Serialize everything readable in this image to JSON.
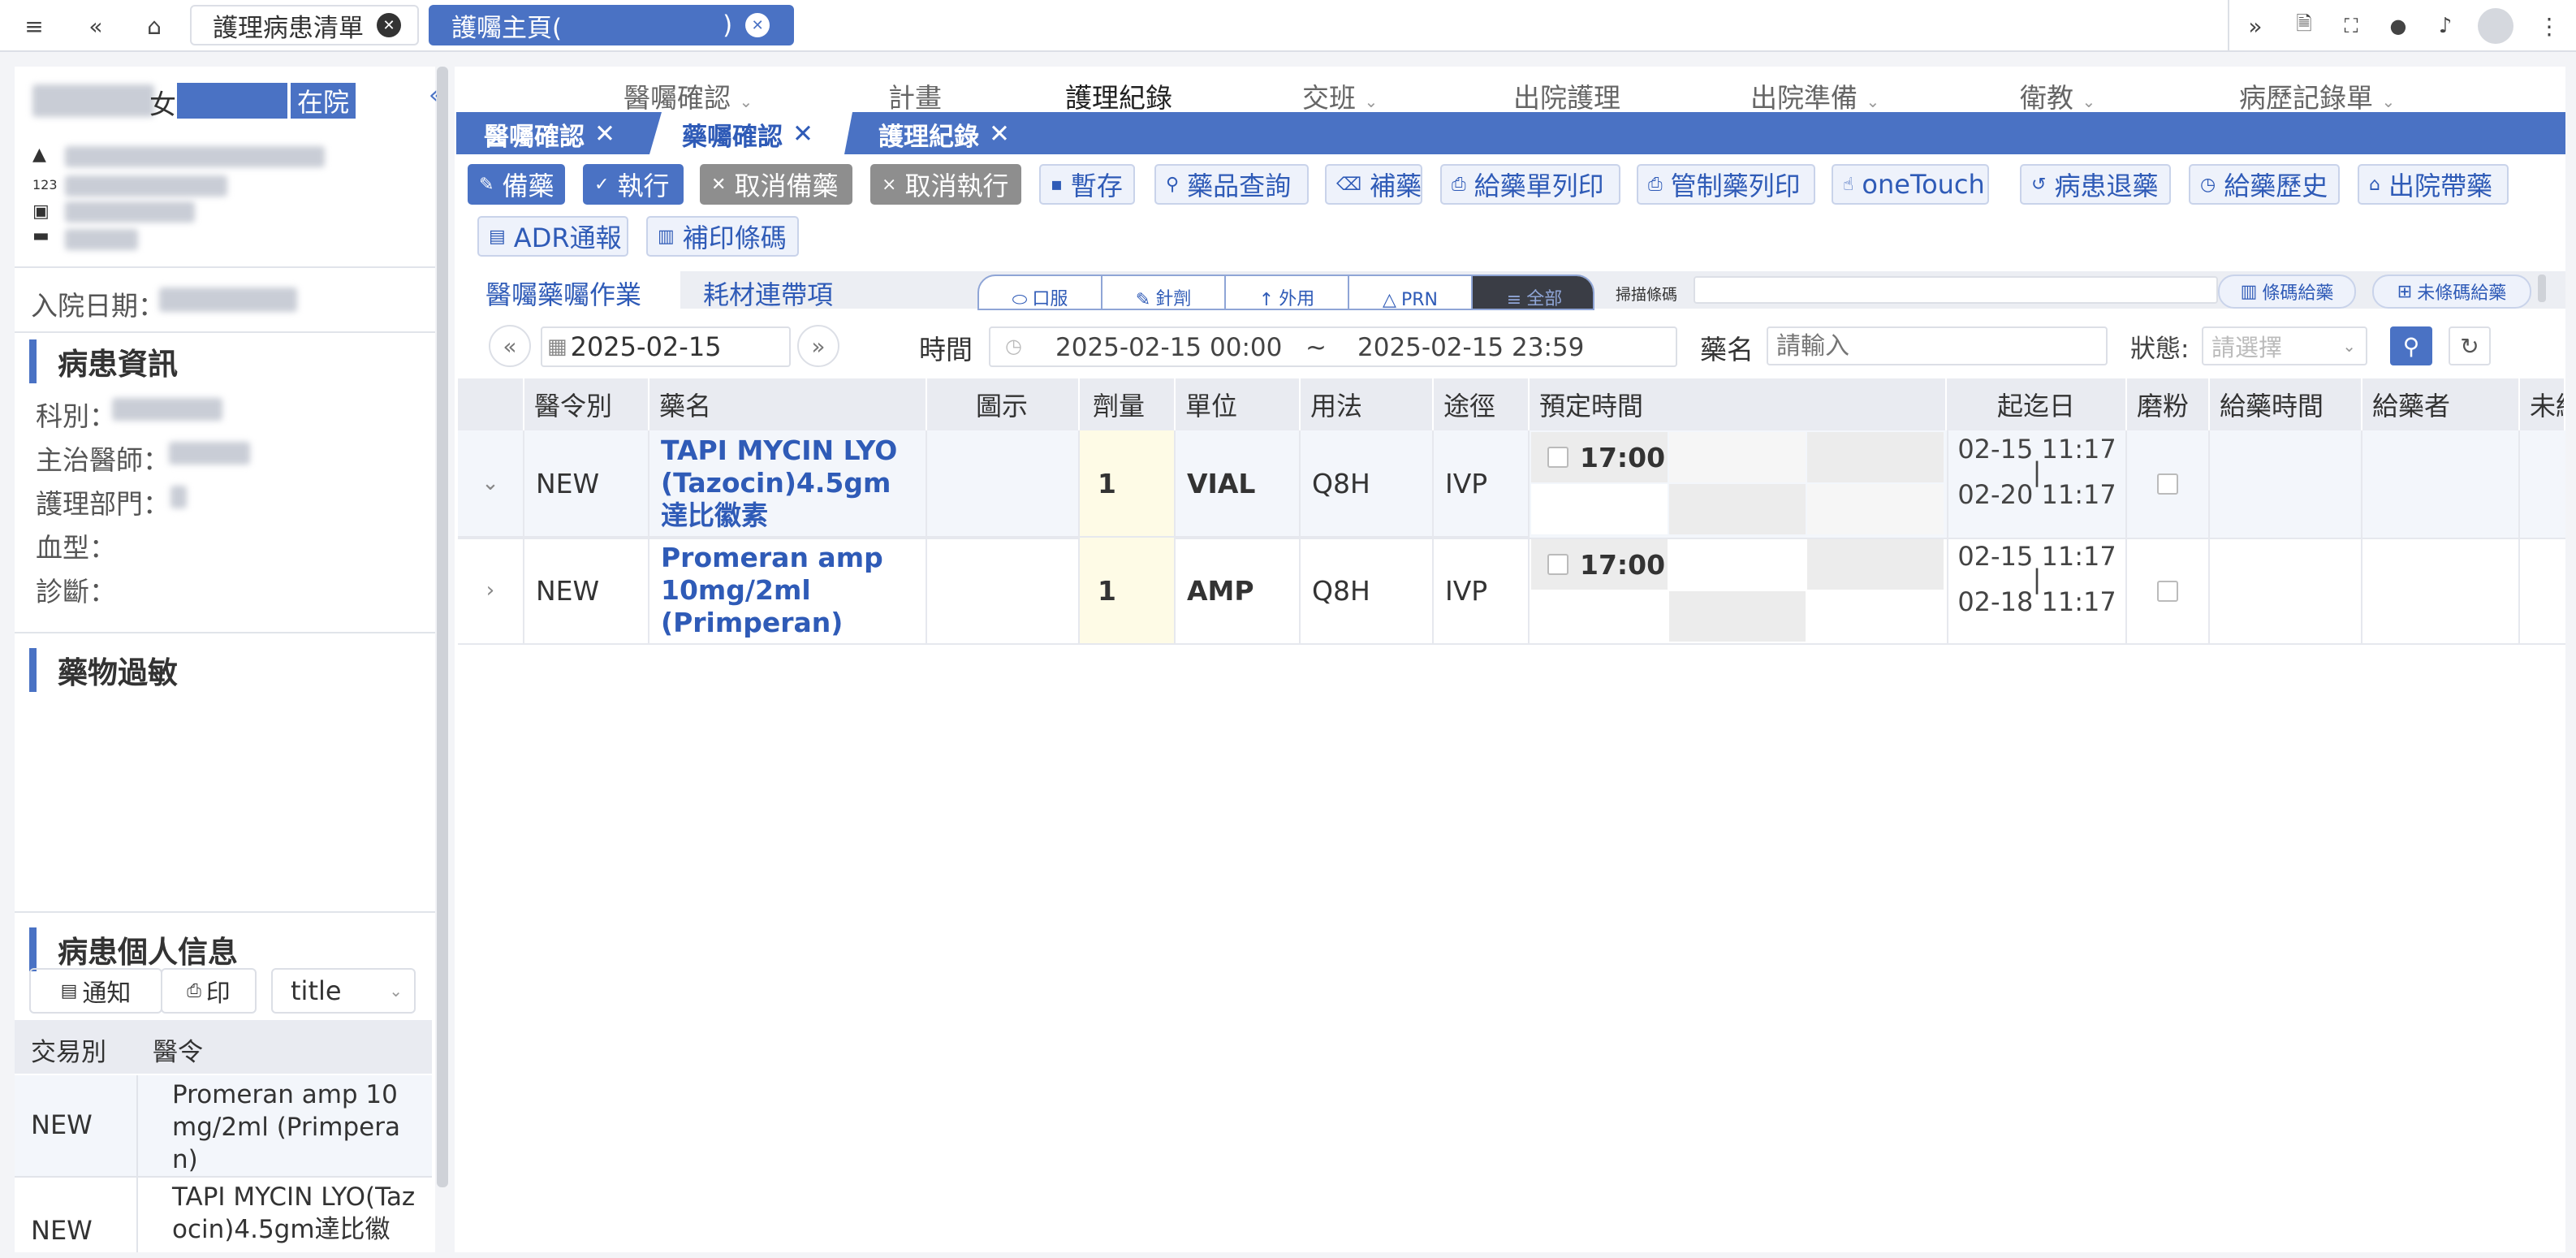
{
  "topbar": {
    "tabs": [
      {
        "label": "護理病患清單"
      },
      {
        "label": "護囑主頁(",
        "suffix": ")"
      }
    ]
  },
  "patient": {
    "gender": "女",
    "status": "在院",
    "admission_label": "入院日期：",
    "info_title": "病患資訊",
    "fields": [
      "科別：",
      "主治醫師：",
      "護理部門：",
      "血型：",
      "診斷："
    ],
    "allergy_title": "藥物過敏",
    "personal_title": "病患個人信息",
    "notify_label": "通知",
    "print_label": "印",
    "title_select": "title",
    "mini_table": {
      "headers": [
        "交易別",
        "醫令"
      ],
      "rows": [
        {
          "type": "NEW",
          "order": "Promeran amp 10mg/2ml (Primperan)"
        },
        {
          "type": "NEW",
          "order": "TAPI MYCIN LYO(Tazocin)4.5gm達比徽"
        }
      ]
    }
  },
  "nav": {
    "menu": [
      "醫囑確認",
      "計畫",
      "護理紀錄",
      "交班",
      "出院護理",
      "出院準備",
      "衛教",
      "病歷記錄單"
    ],
    "subtabs": [
      "醫囑確認",
      "藥囑確認",
      "護理紀錄"
    ]
  },
  "toolbar": {
    "buttons": [
      "備藥",
      "執行",
      "取消備藥",
      "取消執行",
      "暫存",
      "藥品查詢",
      "補藥",
      "給藥單列印",
      "管制藥列印",
      "oneTouch",
      "病患退藥",
      "給藥歷史",
      "出院帶藥",
      "ADR通報",
      "補印條碼"
    ]
  },
  "work": {
    "tab_active": "醫囑藥囑作業",
    "tab_other": "耗材連帶項",
    "routes": [
      "口服",
      "針劑",
      "外用",
      "PRN",
      "全部"
    ],
    "scan_label": "掃描條碼",
    "barcode_btn": "條碼給藥",
    "nobarcode_btn": "未條碼給藥"
  },
  "filters": {
    "date": "2025-02-15",
    "time_label": "時間",
    "time_from": "2025-02-15 00:00",
    "time_sep": "~",
    "time_to": "2025-02-15 23:59",
    "name_label": "藥名",
    "name_placeholder": "請輸入",
    "status_label": "狀態:",
    "status_placeholder": "請選擇"
  },
  "table": {
    "headers": [
      "醫令別",
      "藥名",
      "圖示",
      "劑量",
      "單位",
      "用法",
      "途徑",
      "預定時間",
      "起迄日",
      "磨粉",
      "給藥時間",
      "給藥者",
      "未給"
    ],
    "rows": [
      {
        "type": "NEW",
        "name": "TAPI MYCIN LYO(Tazocin)4.5gm達比徽素",
        "dose": "1",
        "unit": "VIAL",
        "freq": "Q8H",
        "route": "IVP",
        "time": "17:00",
        "start": "02-15 11:17",
        "end": "02-20 11:17"
      },
      {
        "type": "NEW",
        "name": "Promeran amp 10mg/2ml (Primperan)",
        "dose": "1",
        "unit": "AMP",
        "freq": "Q8H",
        "route": "IVP",
        "time": "17:00",
        "start": "02-15 11:17",
        "end": "02-18 11:17"
      }
    ]
  }
}
